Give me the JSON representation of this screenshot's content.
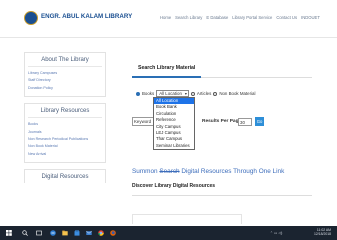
{
  "site": {
    "title": "ENGR. ABUL KALAM LIBRARY"
  },
  "topnav": [
    "Home",
    "Search Library",
    "E Database",
    "Library Portal Service",
    "Contact Us",
    "INDOUET"
  ],
  "sidebar": {
    "about": {
      "title": "About The Library",
      "links": [
        "Library Campuses",
        "Staff Directory",
        "Donation Policy"
      ]
    },
    "resources": {
      "title": "Library Resources",
      "links": [
        "Books",
        "Journals",
        "Non Research Periodical Publications",
        "Non Book Material",
        "New Arrival"
      ]
    },
    "digital": {
      "title": "Digital Resources"
    }
  },
  "search": {
    "tab_label": "Search Library Material",
    "radio_books": "Books",
    "location_value": "All Location",
    "radio_articles": "Articles",
    "radio_nonbook": "Non Book Material",
    "keyword_value": "Keyword",
    "results_label": "Results Per Page",
    "results_value": "30",
    "go_label": "Go"
  },
  "location_options": [
    "All Location",
    "Book Bank",
    "Circulation",
    "Reference",
    "City Campus",
    "LEJ Campus",
    "Thar Campus",
    "Seminar Libraries"
  ],
  "summon": {
    "prefix": "Summon",
    "strike": "Search",
    "rest": " Digital Resources Through One Link"
  },
  "discover": {
    "tab_label": "Discover Library Digital Resources"
  },
  "taskbar": {
    "time": "11:02 AM",
    "date": "12/18/2018"
  },
  "colors": {
    "brand": "#1a4f91",
    "link": "#5a79b2",
    "accent": "#2e8fd8",
    "selected": "#1e73e8",
    "taskbar": "#1b2430"
  }
}
